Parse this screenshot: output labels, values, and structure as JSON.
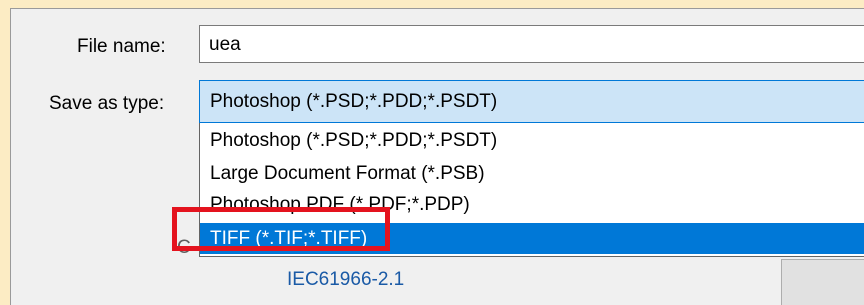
{
  "file_name": {
    "label": "File name:",
    "value": "uea"
  },
  "save_as_type": {
    "label": "Save as type:",
    "selected": "Photoshop (*.PSD;*.PDD;*.PSDT)",
    "options": [
      "Photoshop (*.PSD;*.PDD;*.PSDT)",
      "Large Document Format (*.PSB)",
      "Photoshop PDF (*.PDF;*.PDP)",
      "TIFF (*.TIF;*.TIFF)"
    ],
    "highlighted_index": 3
  },
  "background": {
    "partial_text": "C",
    "color_profile_link": "IEC61966-2.1"
  },
  "colors": {
    "page_background": "#fcecc4",
    "dialog_background": "#f0f0f0",
    "selection_blue": "#0078d7",
    "selected_field": "#cce4f7",
    "annotation_red": "#e4131e"
  }
}
